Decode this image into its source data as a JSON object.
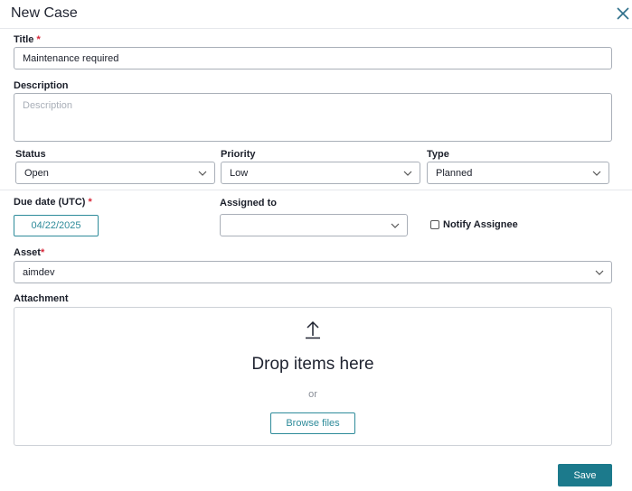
{
  "dialog": {
    "title": "New Case"
  },
  "fields": {
    "title": {
      "label": "Title",
      "required": "*",
      "value": "Maintenance required"
    },
    "description": {
      "label": "Description",
      "placeholder": "Description",
      "value": ""
    },
    "status": {
      "label": "Status",
      "value": "Open"
    },
    "priority": {
      "label": "Priority",
      "value": "Low"
    },
    "type": {
      "label": "Type",
      "value": "Planned"
    },
    "due_date": {
      "label": "Due date (UTC)",
      "required": "*",
      "value": "04/22/2025"
    },
    "assigned_to": {
      "label": "Assigned to",
      "value": ""
    },
    "notify": {
      "label": "Notify Assignee",
      "checked": false
    },
    "asset": {
      "label": "Asset",
      "required": "*",
      "value": "aimdev"
    },
    "attachment": {
      "label": "Attachment",
      "drop_text": "Drop items here",
      "or_text": "or",
      "browse_label": "Browse files"
    }
  },
  "footer": {
    "save_label": "Save"
  },
  "colors": {
    "accent": "#2e8b9a",
    "save_button": "#1c7a8c",
    "required": "#d72638"
  },
  "icons": [
    "close-icon",
    "chevron-down-icon",
    "upload-icon",
    "checkbox-icon"
  ]
}
